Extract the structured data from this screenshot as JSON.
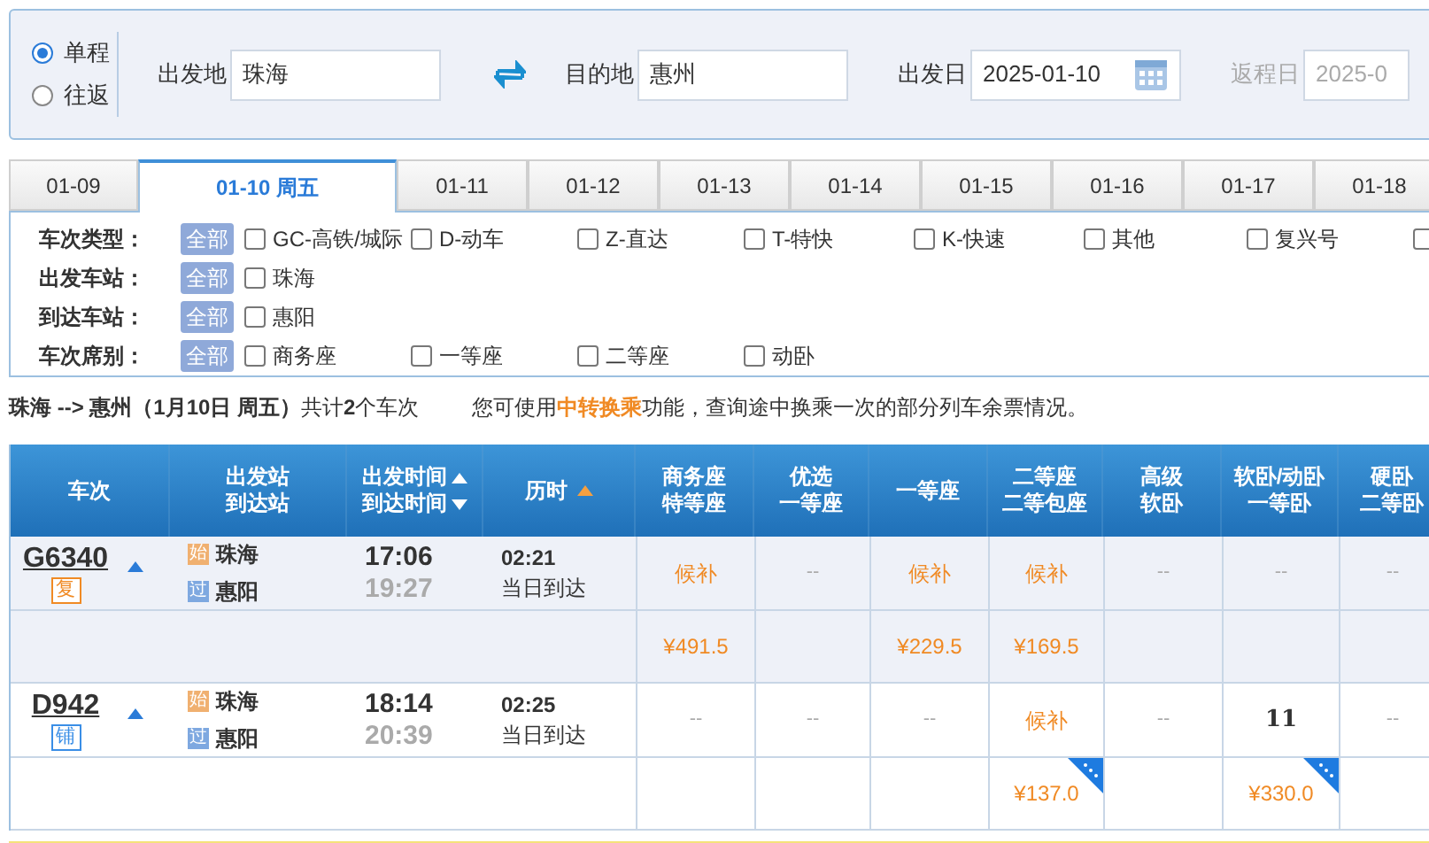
{
  "trip_type": [
    {
      "label": "单程",
      "selected": true
    },
    {
      "label": "往返",
      "selected": false
    }
  ],
  "search": [
    {
      "label": "出发地",
      "value": "珠海",
      "kind": "city",
      "disabled": false
    },
    {
      "label": "目的地",
      "value": "惠州",
      "kind": "city",
      "disabled": false
    },
    {
      "label": "出发日",
      "value": "2025-01-10",
      "kind": "date",
      "disabled": false
    },
    {
      "label": "返程日",
      "value": "2025-0",
      "kind": "date",
      "disabled": true
    }
  ],
  "date_tabs": [
    {
      "label": "01-09",
      "selected": false
    },
    {
      "label": "01-10 周五",
      "selected": true
    },
    {
      "label": "01-11",
      "selected": false
    },
    {
      "label": "01-12",
      "selected": false
    },
    {
      "label": "01-13",
      "selected": false
    },
    {
      "label": "01-14",
      "selected": false
    },
    {
      "label": "01-15",
      "selected": false
    },
    {
      "label": "01-16",
      "selected": false
    },
    {
      "label": "01-17",
      "selected": false
    },
    {
      "label": "01-18",
      "selected": false
    }
  ],
  "filters": [
    {
      "label": "车次类型：",
      "all": "全部",
      "options": [
        {
          "label": "GC-高铁/城际",
          "checked": false
        },
        {
          "label": "D-动车",
          "checked": false
        },
        {
          "label": "Z-直达",
          "checked": false
        },
        {
          "label": "T-特快",
          "checked": false
        },
        {
          "label": "K-快速",
          "checked": false
        },
        {
          "label": "其他",
          "checked": false
        },
        {
          "label": "复兴号",
          "checked": false
        },
        {
          "checked": false
        }
      ]
    },
    {
      "label": "出发车站：",
      "all": "全部",
      "options": [
        {
          "label": "珠海",
          "checked": false
        }
      ]
    },
    {
      "label": "到达车站：",
      "all": "全部",
      "options": [
        {
          "label": "惠阳",
          "checked": false
        }
      ]
    },
    {
      "label": "车次席别：",
      "all": "全部",
      "options": [
        {
          "label": "商务座",
          "checked": false
        },
        {
          "label": "一等座",
          "checked": false
        },
        {
          "label": "二等座",
          "checked": false
        },
        {
          "label": "动卧",
          "checked": false
        }
      ]
    }
  ],
  "summary": {
    "text": "**珠海 --> 惠州（1月10日 周五）**共计**2**个车次",
    "notice_before": "您可使用",
    "notice_link": "中转换乘",
    "notice_after": "功能，查询途中换乘一次的部分列车余票情况。"
  },
  "table": {
    "columns": [
      {
        "lines": [
          "车次"
        ]
      },
      {
        "lines": [
          "出发站",
          "到达站"
        ]
      },
      {
        "lines": [
          "出发时间",
          "到达时间"
        ],
        "kind": "sort_pair"
      },
      {
        "lines": [
          "历时"
        ],
        "kind": "sort_up"
      },
      {
        "lines": [
          "商务座",
          "特等座"
        ]
      },
      {
        "lines": [
          "优选",
          "一等座"
        ]
      },
      {
        "lines": [
          "一等座"
        ]
      },
      {
        "lines": [
          "二等座",
          "二等包座"
        ]
      },
      {
        "lines": [
          "高级",
          "软卧"
        ]
      },
      {
        "lines": [
          "软卧/动卧",
          "一等卧"
        ]
      },
      {
        "lines": [
          "硬卧",
          "二等卧"
        ]
      }
    ],
    "rows": [
      {
        "train": "G6340",
        "badge": {
          "text": "复",
          "color": "#f08a24"
        },
        "from": {
          "tag": "始",
          "name": "珠海"
        },
        "to": {
          "tag": "过",
          "name": "惠阳"
        },
        "depart": "17:06",
        "arrive": "19:27",
        "duration": "02:21",
        "arrival_day": "当日到达",
        "seats": [
          {
            "text": "候补",
            "kind": "waitlist"
          },
          {
            "text": "--",
            "kind": "none"
          },
          {
            "text": "候补",
            "kind": "waitlist"
          },
          {
            "text": "候补",
            "kind": "waitlist"
          },
          {
            "text": "--",
            "kind": "none"
          },
          {
            "text": "--",
            "kind": "none"
          },
          {
            "text": "--",
            "kind": "none"
          }
        ],
        "prices": [
          {
            "kind": "price",
            "text": "¥491.5",
            "corner": false
          },
          {
            "kind": "empty"
          },
          {
            "kind": "price",
            "text": "¥229.5",
            "corner": false
          },
          {
            "kind": "price",
            "text": "¥169.5",
            "corner": false
          },
          {
            "kind": "empty"
          },
          {
            "kind": "empty"
          },
          {
            "kind": "empty"
          }
        ]
      },
      {
        "train": "D942",
        "badge": {
          "text": "铺",
          "color": "#3a8ee6"
        },
        "from": {
          "tag": "始",
          "name": "珠海"
        },
        "to": {
          "tag": "过",
          "name": "惠阳"
        },
        "depart": "18:14",
        "arrive": "20:39",
        "duration": "02:25",
        "arrival_day": "当日到达",
        "seats": [
          {
            "text": "--",
            "kind": "none"
          },
          {
            "text": "--",
            "kind": "none"
          },
          {
            "text": "--",
            "kind": "none"
          },
          {
            "text": "候补",
            "kind": "waitlist"
          },
          {
            "text": "--",
            "kind": "none"
          },
          {
            "text": "11",
            "kind": "count"
          },
          {
            "text": "--",
            "kind": "none"
          }
        ],
        "prices": [
          {
            "kind": "empty"
          },
          {
            "kind": "empty"
          },
          {
            "kind": "empty"
          },
          {
            "kind": "price",
            "text": "¥137.0",
            "corner": true
          },
          {
            "kind": "empty"
          },
          {
            "kind": "price",
            "text": "¥330.0",
            "corner": true
          },
          {
            "kind": "empty"
          }
        ]
      }
    ]
  }
}
